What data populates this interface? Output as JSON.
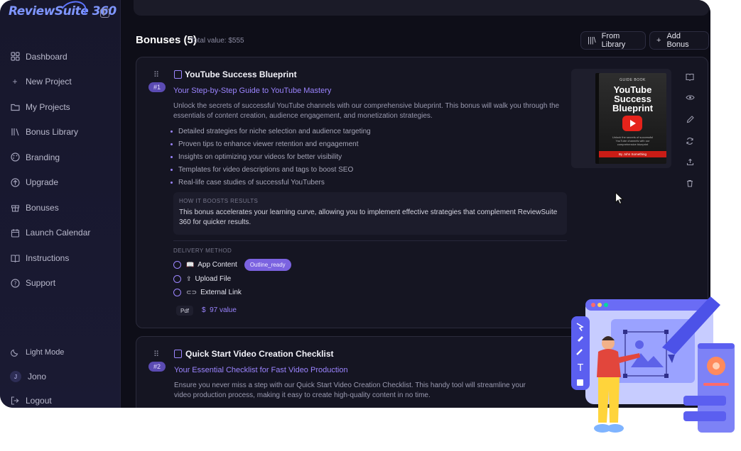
{
  "sidebar": {
    "logo_text": "ReviewSuite 360",
    "items": [
      {
        "label": "Dashboard",
        "icon": "dashboard-icon"
      },
      {
        "label": "New Project",
        "icon": "plus-icon"
      },
      {
        "label": "My Projects",
        "icon": "folder-icon"
      },
      {
        "label": "Bonus Library",
        "icon": "library-icon"
      },
      {
        "label": "Branding",
        "icon": "palette-icon"
      },
      {
        "label": "Upgrade",
        "icon": "arrow-up-circle-icon"
      },
      {
        "label": "Bonuses",
        "icon": "gift-icon"
      },
      {
        "label": "Launch Calendar",
        "icon": "calendar-icon"
      },
      {
        "label": "Instructions",
        "icon": "book-icon"
      },
      {
        "label": "Support",
        "icon": "help-circle-icon"
      }
    ],
    "light_mode_label": "Light Mode",
    "user_initial": "J",
    "user_name": "Jono",
    "logout_label": "Logout"
  },
  "header": {
    "title": "Bonuses (5)",
    "total_value": "Total value: $555",
    "from_library_label": "From Library",
    "add_bonus_label": "Add Bonus"
  },
  "bonus1": {
    "number": "#1",
    "title": "YouTube Success Blueprint",
    "subtitle": "Your Step-by-Step Guide to YouTube Mastery",
    "description": "Unlock the secrets of successful YouTube channels with our comprehensive blueprint. This bonus will walk you through the essentials of content creation, audience engagement, and monetization strategies.",
    "bullets": [
      "Detailed strategies for niche selection and audience targeting",
      "Proven tips to enhance viewer retention and engagement",
      "Insights on optimizing your videos for better visibility",
      "Templates for video descriptions and tags to boost SEO",
      "Real-life case studies of successful YouTubers"
    ],
    "boost_label": "HOW IT BOOSTS RESULTS",
    "boost_text": "This bonus accelerates your learning curve, allowing you to implement effective strategies that complement ReviewSuite 360 for quicker results.",
    "delivery_label": "DELIVERY METHOD",
    "delivery_options": [
      {
        "label": "App Content",
        "icon": "book-open-icon"
      },
      {
        "label": "Upload File",
        "icon": "upload-icon"
      },
      {
        "label": "External Link",
        "icon": "link-icon"
      }
    ],
    "status_pill": "Outline_ready",
    "format": "Pdf",
    "value_label": "97 value",
    "cover": {
      "guide_text": "GUIDE BOOK",
      "title": "YouTube Success Blueprint",
      "blurb": "Unlock the secrets of successful YouTube channels with our comprehensive blueprint",
      "author": "By John Something",
      "spine": "YouTube Success Blueprint"
    }
  },
  "bonus2": {
    "number": "#2",
    "title": "Quick Start Video Creation Checklist",
    "subtitle": "Your Essential Checklist for Fast Video Production",
    "description": "Ensure you never miss a step with our Quick Start Video Creation Checklist. This handy tool will streamline your video production process, making it easy to create high-quality content in no time."
  },
  "card_actions": [
    "book-open-icon",
    "eye-icon",
    "pencil-icon",
    "refresh-icon",
    "share-icon",
    "trash-icon"
  ],
  "colors": {
    "accent": "#9b84ff",
    "badge": "#5b4bb3",
    "pill": "#7b63e0",
    "background": "#0e0e18",
    "card": "#151522"
  }
}
